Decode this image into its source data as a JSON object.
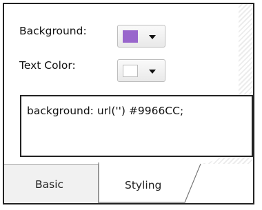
{
  "styling_panel": {
    "background_label": "Background:",
    "background_color": "#9966CC",
    "text_color_label": "Text Color:",
    "text_color": "#FFFFFF",
    "css_text": "background: url('') #9966CC;",
    "icons": {
      "background_dropdown": "chevron-down-icon",
      "text_color_dropdown": "chevron-down-icon"
    }
  },
  "tabs": [
    {
      "label": "Basic",
      "active": false
    },
    {
      "label": "Styling",
      "active": true
    }
  ]
}
